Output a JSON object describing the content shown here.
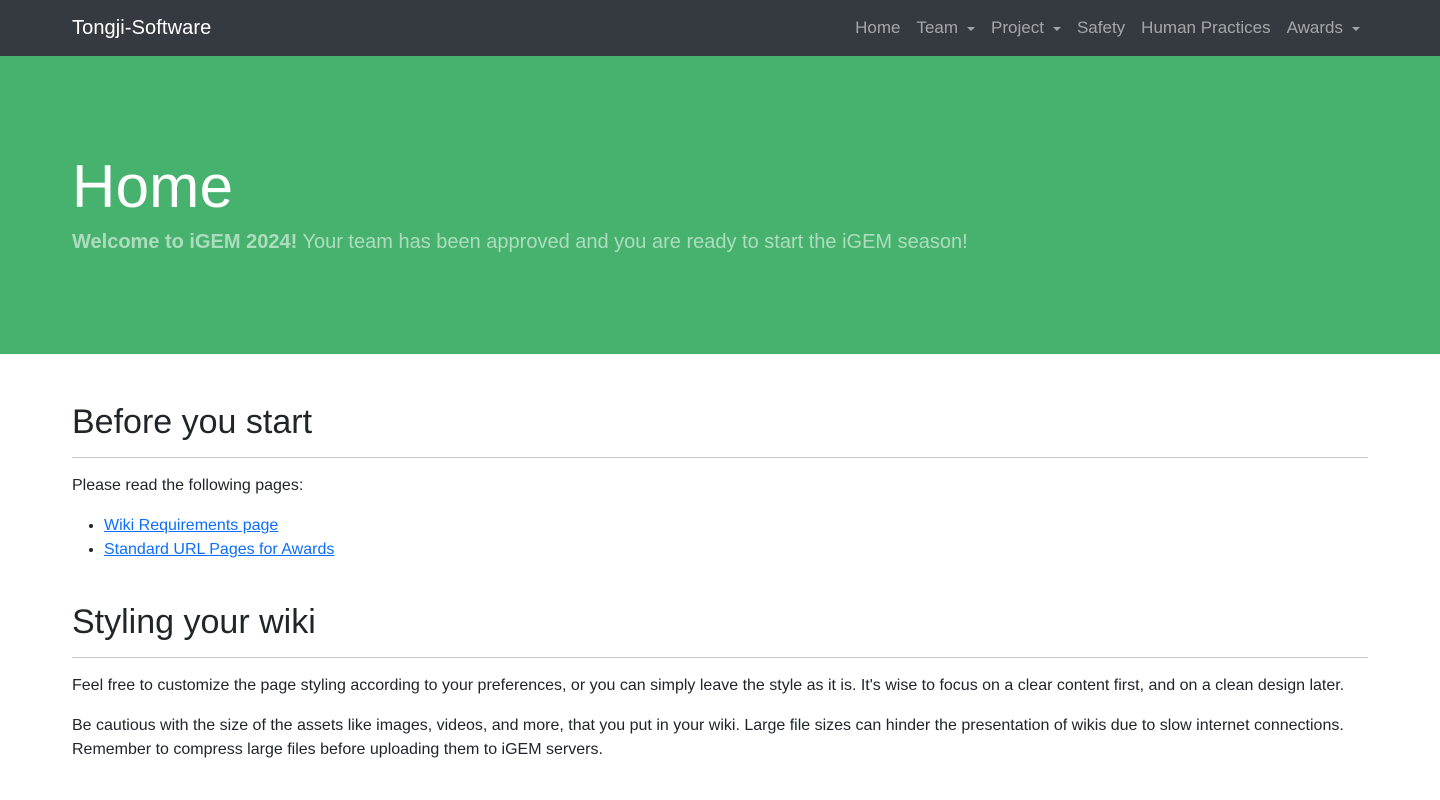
{
  "navbar": {
    "brand": "Tongji-Software",
    "items": [
      {
        "label": "Home",
        "dropdown": false
      },
      {
        "label": "Team",
        "dropdown": true
      },
      {
        "label": "Project",
        "dropdown": true
      },
      {
        "label": "Safety",
        "dropdown": false
      },
      {
        "label": "Human Practices",
        "dropdown": false
      },
      {
        "label": "Awards",
        "dropdown": true
      }
    ]
  },
  "hero": {
    "title": "Home",
    "lead_strong": "Welcome to iGEM 2024!",
    "lead_rest": " Your team has been approved and you are ready to start the iGEM season!"
  },
  "sections": {
    "before": {
      "heading": "Before you start",
      "intro": "Please read the following pages:",
      "links": [
        "Wiki Requirements page",
        "Standard URL Pages for Awards"
      ]
    },
    "styling": {
      "heading": "Styling your wiki",
      "paragraphs": [
        "Feel free to customize the page styling according to your preferences, or you can simply leave the style as it is. It's wise to focus on a clear content first, and on a clean design later.",
        "Be cautious with the size of the assets like images, videos, and more, that you put in your wiki. Large file sizes can hinder the presentation of wikis due to slow internet connections. Remember to compress large files before uploading them to iGEM servers."
      ]
    }
  },
  "colors": {
    "navbar_bg": "#343a40",
    "hero_bg": "#47b26d",
    "link": "#0d6efd"
  }
}
